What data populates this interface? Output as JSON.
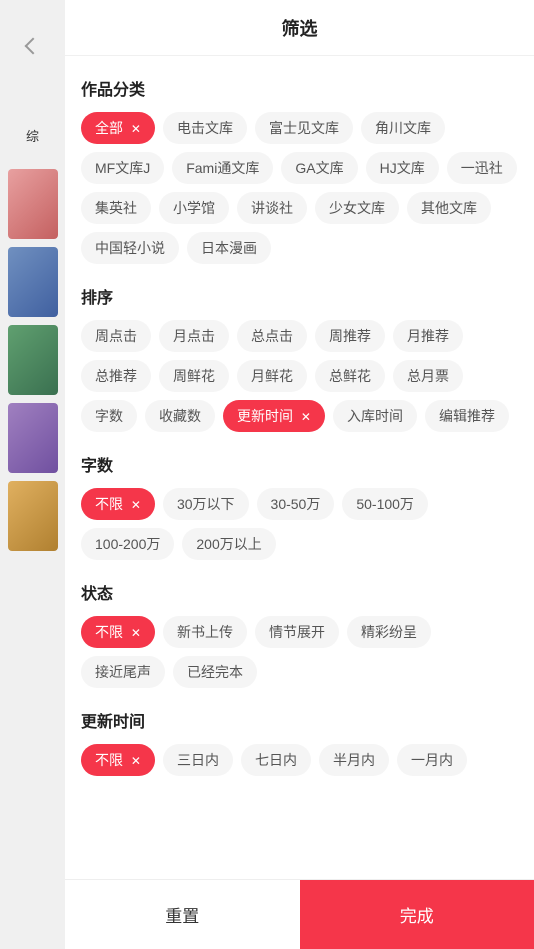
{
  "header": {
    "title": "筛选",
    "back_icon": "chevron-left"
  },
  "sections": {
    "category": {
      "title": "作品分类",
      "tags": [
        {
          "label": "全部",
          "active": true,
          "has_close": true
        },
        {
          "label": "电击文库",
          "active": false
        },
        {
          "label": "富士见文库",
          "active": false
        },
        {
          "label": "角川文库",
          "active": false
        },
        {
          "label": "MF文库J",
          "active": false
        },
        {
          "label": "Fami通文库",
          "active": false
        },
        {
          "label": "GA文库",
          "active": false
        },
        {
          "label": "HJ文库",
          "active": false
        },
        {
          "label": "一迅社",
          "active": false
        },
        {
          "label": "集英社",
          "active": false
        },
        {
          "label": "小学馆",
          "active": false
        },
        {
          "label": "讲谈社",
          "active": false
        },
        {
          "label": "少女文库",
          "active": false
        },
        {
          "label": "其他文库",
          "active": false
        },
        {
          "label": "中国轻小说",
          "active": false
        },
        {
          "label": "日本漫画",
          "active": false
        }
      ]
    },
    "sort": {
      "title": "排序",
      "tags": [
        {
          "label": "周点击",
          "active": false
        },
        {
          "label": "月点击",
          "active": false
        },
        {
          "label": "总点击",
          "active": false
        },
        {
          "label": "周推荐",
          "active": false
        },
        {
          "label": "月推荐",
          "active": false
        },
        {
          "label": "总推荐",
          "active": false
        },
        {
          "label": "周鲜花",
          "active": false
        },
        {
          "label": "月鲜花",
          "active": false
        },
        {
          "label": "总鲜花",
          "active": false
        },
        {
          "label": "总月票",
          "active": false
        },
        {
          "label": "字数",
          "active": false
        },
        {
          "label": "收藏数",
          "active": false
        },
        {
          "label": "更新时间",
          "active": true,
          "has_close": true
        },
        {
          "label": "入库时间",
          "active": false
        },
        {
          "label": "编辑推荐",
          "active": false
        }
      ]
    },
    "word_count": {
      "title": "字数",
      "tags": [
        {
          "label": "不限",
          "active": true,
          "has_close": true
        },
        {
          "label": "30万以下",
          "active": false
        },
        {
          "label": "30-50万",
          "active": false
        },
        {
          "label": "50-100万",
          "active": false
        },
        {
          "label": "100-200万",
          "active": false
        },
        {
          "label": "200万以上",
          "active": false
        }
      ]
    },
    "status": {
      "title": "状态",
      "tags": [
        {
          "label": "不限",
          "active": true,
          "has_close": true
        },
        {
          "label": "新书上传",
          "active": false
        },
        {
          "label": "情节展开",
          "active": false
        },
        {
          "label": "精彩纷呈",
          "active": false
        },
        {
          "label": "接近尾声",
          "active": false
        },
        {
          "label": "已经完本",
          "active": false
        }
      ]
    },
    "update_time": {
      "title": "更新时间",
      "tags": [
        {
          "label": "不限",
          "active": true,
          "has_close": true
        },
        {
          "label": "三日内",
          "active": false
        },
        {
          "label": "七日内",
          "active": false
        },
        {
          "label": "半月内",
          "active": false
        },
        {
          "label": "一月内",
          "active": false
        }
      ]
    }
  },
  "footer": {
    "reset_label": "重置",
    "confirm_label": "完成"
  },
  "side": {
    "pill_label": "综"
  }
}
